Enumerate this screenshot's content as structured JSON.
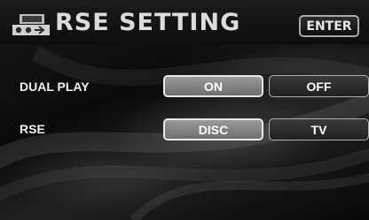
{
  "header": {
    "title": "RSE SETTING",
    "enter_label": "ENTER"
  },
  "rows": [
    {
      "label": "DUAL PLAY",
      "options": [
        {
          "label": "ON",
          "selected": true
        },
        {
          "label": "OFF",
          "selected": false
        }
      ]
    },
    {
      "label": "RSE",
      "options": [
        {
          "label": "DISC",
          "selected": true
        },
        {
          "label": "TV",
          "selected": false
        }
      ]
    }
  ],
  "icons": {
    "title": "rse-player-icon"
  },
  "colors": {
    "selected_fill": "#8a8a8a",
    "unselected_fill": "#2e2e2e",
    "text": "#ffffff"
  }
}
